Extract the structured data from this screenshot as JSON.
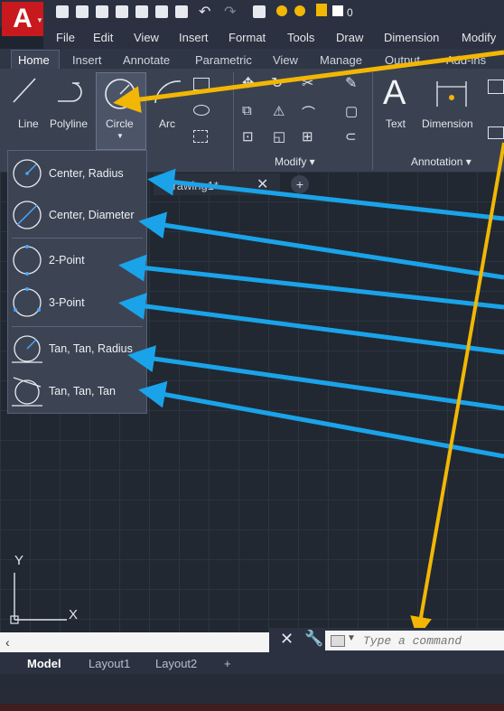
{
  "app": {
    "logo_letter": "A",
    "undo_count": "0"
  },
  "menubar": {
    "items": [
      "File",
      "Edit",
      "View",
      "Insert",
      "Format",
      "Tools",
      "Draw",
      "Dimension",
      "Modify"
    ]
  },
  "ribbon_tabs": {
    "items": [
      "Home",
      "Insert",
      "Annotate",
      "Parametric",
      "View",
      "Manage",
      "Output",
      "Add-ins"
    ]
  },
  "ribbon": {
    "line_label": "Line",
    "polyline_label": "Polyline",
    "circle_label": "Circle",
    "arc_label": "Arc",
    "text_label": "Text",
    "dimension_label": "Dimension",
    "modify_panel": "Modify ▾",
    "annotation_panel": "Annotation ▾"
  },
  "doc_tab": {
    "label": "Drawing1*",
    "close": "✕",
    "plus": "+"
  },
  "circle_menu": {
    "items": [
      "Center, Radius",
      "Center, Diameter",
      "2-Point",
      "3-Point",
      "Tan, Tan, Radius",
      "Tan, Tan, Tan"
    ]
  },
  "ucs": {
    "x": "X",
    "y": "Y"
  },
  "command": {
    "placeholder": "Type a command"
  },
  "layout_tabs": {
    "items": [
      "Model",
      "Layout1",
      "Layout2"
    ],
    "plus": "+"
  },
  "colors": {
    "accent_red": "#c8191e",
    "arrow_blue": "#1aa3e8",
    "arrow_yellow": "#f2b705"
  }
}
